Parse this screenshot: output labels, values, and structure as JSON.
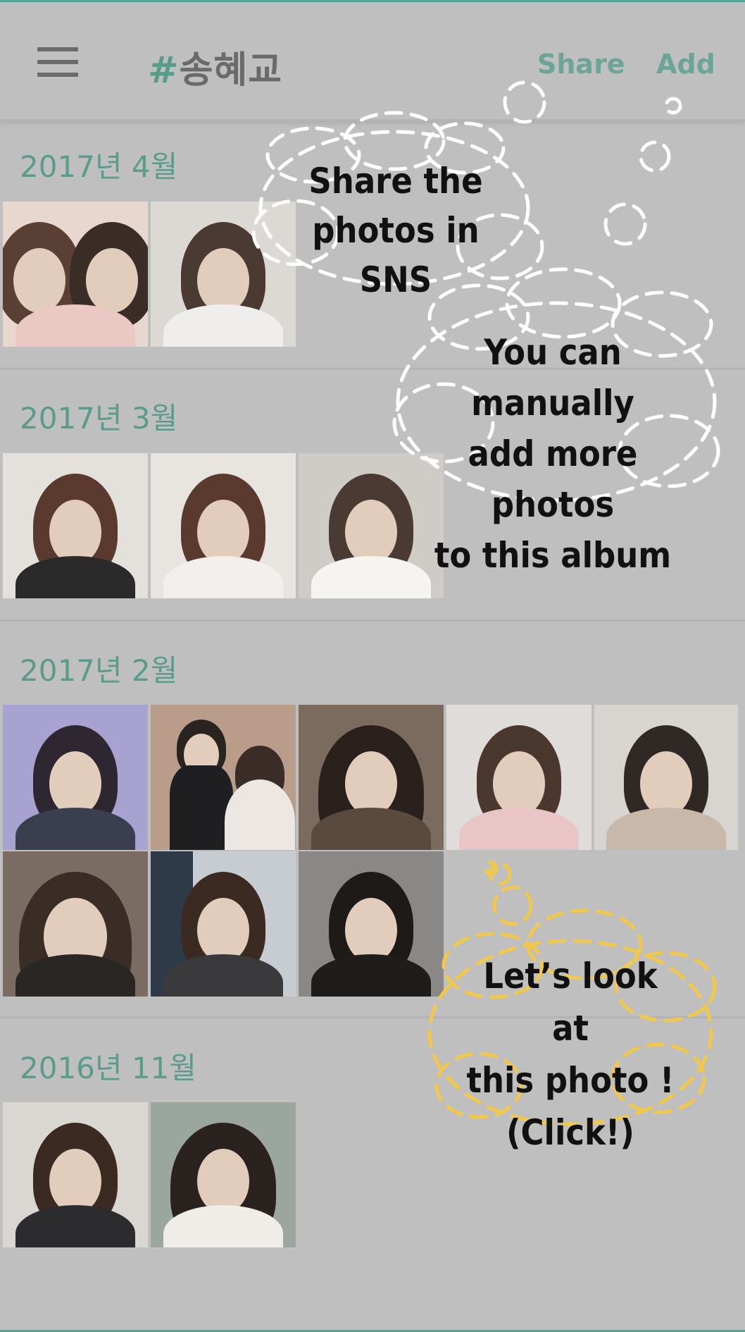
{
  "app_bar": {
    "title_hash": "#",
    "title_text": "송혜교",
    "share_label": "Share",
    "add_label": "Add"
  },
  "sections": [
    {
      "title": "2017년 4월",
      "photo_count": 2
    },
    {
      "title": "2017년 3월",
      "photo_count": 3
    },
    {
      "title": "2017년 2월",
      "photo_count": 8
    },
    {
      "title": "2016년 11월",
      "photo_count": 2
    }
  ],
  "callouts": {
    "share": [
      "Share the",
      "photos in SNS"
    ],
    "add": [
      "You can manually",
      "add more photos",
      "to this album"
    ],
    "look": [
      "Let’s look at",
      "this photo !",
      "(Click!)"
    ]
  },
  "colors": {
    "accent": "#5a9c8c",
    "overlay_bg": "#bfbfbf",
    "cloud_white": "#ffffff",
    "cloud_yellow": "#f2c84b"
  },
  "icons": {
    "menu": "hamburger-menu-icon"
  }
}
